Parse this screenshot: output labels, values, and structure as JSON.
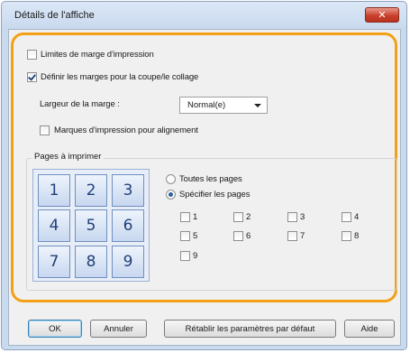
{
  "window": {
    "title": "Détails de l'affiche",
    "close_glyph": "✕"
  },
  "options": {
    "print_margin_limits": {
      "label": "Limites de marge d'impression",
      "checked": false
    },
    "set_margins_cut_paste": {
      "label": "Définir les marges pour la coupe/le collage",
      "checked": true
    },
    "margin_width": {
      "label": "Largeur de la marge :",
      "value": "Normal(e)"
    },
    "alignment_marks": {
      "label": "Marques d'impression pour alignement",
      "checked": false
    }
  },
  "pages_group": {
    "legend": "Pages à imprimer",
    "tiles": [
      "1",
      "2",
      "3",
      "4",
      "5",
      "6",
      "7",
      "8",
      "9"
    ],
    "all_pages_label": "Toutes les pages",
    "specify_pages_label": "Spécifier les pages",
    "selected": "specify",
    "page_checks": [
      {
        "label": "1",
        "checked": false
      },
      {
        "label": "2",
        "checked": false
      },
      {
        "label": "3",
        "checked": false
      },
      {
        "label": "4",
        "checked": false
      },
      {
        "label": "5",
        "checked": false
      },
      {
        "label": "6",
        "checked": false
      },
      {
        "label": "7",
        "checked": false
      },
      {
        "label": "8",
        "checked": false
      },
      {
        "label": "9",
        "checked": false
      }
    ]
  },
  "buttons": {
    "ok": "OK",
    "cancel": "Annuler",
    "restore_defaults": "Rétablir les paramètres par défaut",
    "help": "Aide"
  },
  "colors": {
    "highlight": "#f2a116",
    "tile_text": "#22407a",
    "close_button": "#c9412c"
  }
}
